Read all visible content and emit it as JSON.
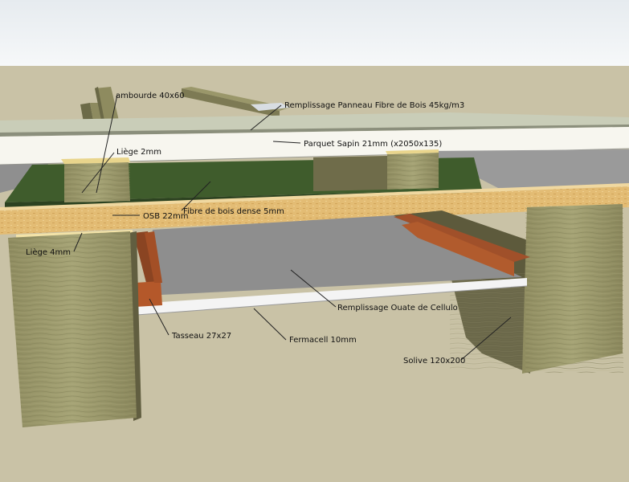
{
  "labels": {
    "lambourde": "ambourde 40x60",
    "remplissage_panneau": "Remplissage Panneau Fibre de Bois 45kg/m3",
    "parquet": "Parquet Sapin 21mm (x2050x135)",
    "liege_top": "Liège 2mm",
    "fibre_dense": "Fibre de bois dense 5mm",
    "osb": "OSB 22mm",
    "liege_bottom": "Liège 4mm",
    "remplissage_ouate": "Remplissage Ouate de Cellulo",
    "tasseau": "Tasseau 27x27",
    "fermacell": "Fermacell 10mm",
    "solive": "Solive 120x200"
  },
  "colors": {
    "sky_top": "#e9eef2",
    "ground": "#c9c2a6",
    "wood_beam": "#9e9b6c",
    "osb": "#e0b870",
    "fibre_board": "#3d5a2a",
    "parquet": "#f7f6ef",
    "fermacell": "#f4f4f4",
    "filling": "#8d8d8d",
    "tasseau": "#b4582a"
  }
}
